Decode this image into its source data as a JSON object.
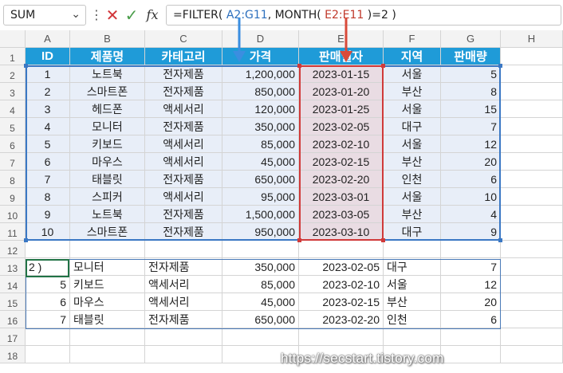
{
  "formula_bar": {
    "name_box": "SUM",
    "formula_prefix": "=FILTER( ",
    "ref1": "A2:G11",
    "formula_mid": ", MONTH( ",
    "ref2": "E2:E11",
    "formula_suffix": " )=2 )"
  },
  "columns": [
    "A",
    "B",
    "C",
    "D",
    "E",
    "F",
    "G",
    "H"
  ],
  "rows": [
    "1",
    "2",
    "3",
    "4",
    "5",
    "6",
    "7",
    "8",
    "9",
    "10",
    "11",
    "12",
    "13",
    "14",
    "15",
    "16",
    "17",
    "18"
  ],
  "table": {
    "headers": [
      "ID",
      "제품명",
      "카테고리",
      "가격",
      "판매일자",
      "지역",
      "판매량"
    ],
    "rows": [
      [
        "1",
        "노트북",
        "전자제품",
        "1,200,000",
        "2023-01-15",
        "서울",
        "5"
      ],
      [
        "2",
        "스마트폰",
        "전자제품",
        "850,000",
        "2023-01-20",
        "부산",
        "8"
      ],
      [
        "3",
        "헤드폰",
        "액세서리",
        "120,000",
        "2023-01-25",
        "서울",
        "15"
      ],
      [
        "4",
        "모니터",
        "전자제품",
        "350,000",
        "2023-02-05",
        "대구",
        "7"
      ],
      [
        "5",
        "키보드",
        "액세서리",
        "85,000",
        "2023-02-10",
        "서울",
        "12"
      ],
      [
        "6",
        "마우스",
        "액세서리",
        "45,000",
        "2023-02-15",
        "부산",
        "20"
      ],
      [
        "7",
        "태블릿",
        "전자제품",
        "650,000",
        "2023-02-20",
        "인천",
        "6"
      ],
      [
        "8",
        "스피커",
        "액세서리",
        "95,000",
        "2023-03-01",
        "서울",
        "10"
      ],
      [
        "9",
        "노트북",
        "전자제품",
        "1,500,000",
        "2023-03-05",
        "부산",
        "4"
      ],
      [
        "10",
        "스마트폰",
        "전자제품",
        "950,000",
        "2023-03-10",
        "대구",
        "9"
      ]
    ]
  },
  "spill": {
    "rows": [
      [
        "2 )",
        "모니터",
        "전자제품",
        "350,000",
        "2023-02-05",
        "대구",
        "7"
      ],
      [
        "5",
        "키보드",
        "액세서리",
        "85,000",
        "2023-02-10",
        "서울",
        "12"
      ],
      [
        "6",
        "마우스",
        "액세서리",
        "45,000",
        "2023-02-15",
        "부산",
        "20"
      ],
      [
        "7",
        "태블릿",
        "전자제품",
        "650,000",
        "2023-02-20",
        "인천",
        "6"
      ]
    ]
  },
  "watermark": "https://secstart.tistory.com",
  "colors": {
    "header_fill": "#1f9bd8",
    "data_fill": "#e8eef8",
    "date_fill": "#e9dce3",
    "blue_ref": "#3b78c4",
    "red_ref": "#d03a3a"
  }
}
